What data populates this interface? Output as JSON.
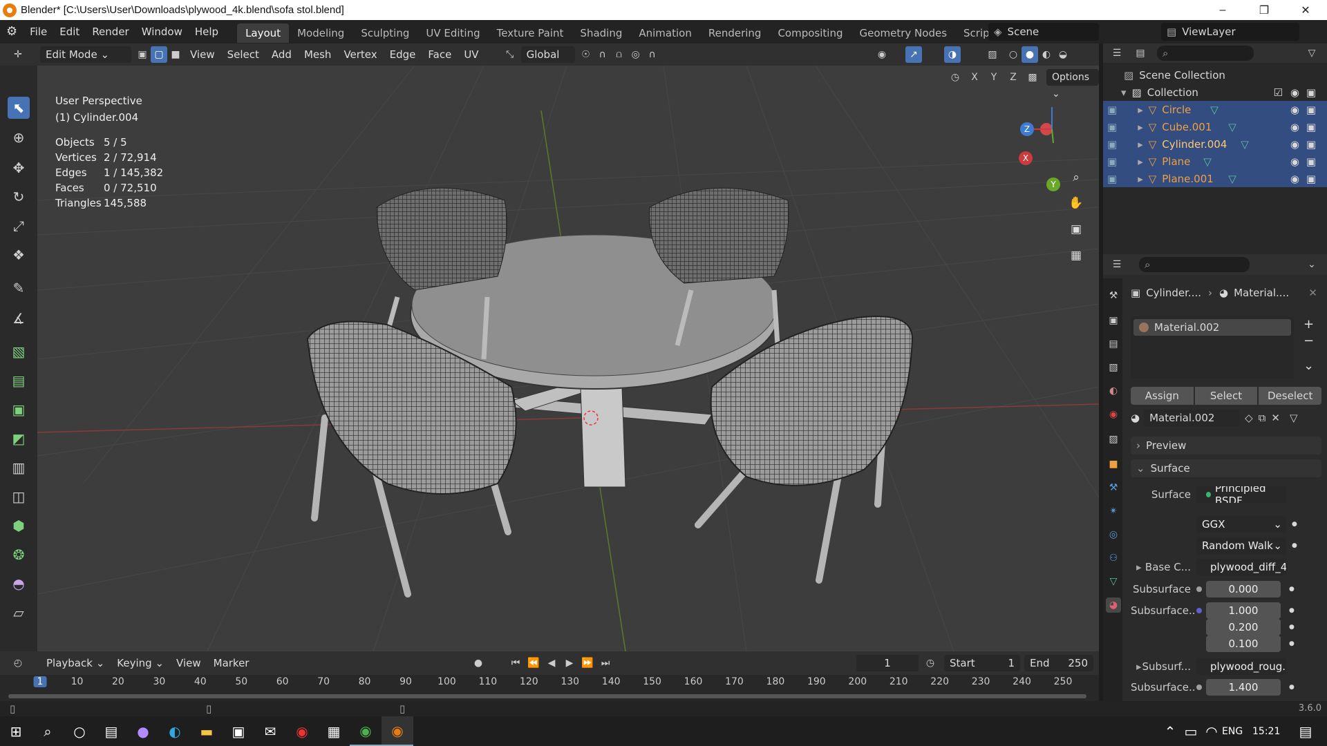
{
  "titlebar": {
    "title": "Blender* [C:\\Users\\User\\Downloads\\plywood_4k.blend\\sofa stol.blend]"
  },
  "menus": [
    "File",
    "Edit",
    "Render",
    "Window",
    "Help"
  ],
  "workspaces": [
    "Layout",
    "Modeling",
    "Sculpting",
    "UV Editing",
    "Texture Paint",
    "Shading",
    "Animation",
    "Rendering",
    "Compositing",
    "Geometry Nodes",
    "Scripting"
  ],
  "scene": {
    "label": "Scene",
    "viewlayer": "ViewLayer"
  },
  "header": {
    "mode": "Edit Mode",
    "items": [
      "View",
      "Select",
      "Add",
      "Mesh",
      "Vertex",
      "Edge",
      "Face",
      "UV"
    ],
    "orientation": "Global",
    "options": "Options",
    "axes": [
      "X",
      "Y",
      "Z"
    ]
  },
  "viewport": {
    "perspective": "User Perspective",
    "object": "(1) Cylinder.004",
    "stats": [
      {
        "label": "Objects",
        "value": "5 / 5"
      },
      {
        "label": "Vertices",
        "value": "2 / 72,914"
      },
      {
        "label": "Edges",
        "value": "1 / 145,382"
      },
      {
        "label": "Faces",
        "value": "0 / 72,510"
      },
      {
        "label": "Triangles",
        "value": "145,588"
      }
    ],
    "gizmo": {
      "x": "X",
      "y": "Y",
      "z": "Z"
    }
  },
  "outliner": {
    "scene_collection": "Scene Collection",
    "collection": "Collection",
    "objects": [
      "Circle",
      "Cube.001",
      "Cylinder.004",
      "Plane",
      "Plane.001"
    ]
  },
  "properties": {
    "breadcrumb_obj": "Cylinder....",
    "breadcrumb_mat": "Material....",
    "slot": "Material.002",
    "assign": "Assign",
    "select": "Select",
    "deselect": "Deselect",
    "material_name": "Material.002",
    "preview": "Preview",
    "surface_panel": "Surface",
    "rows": [
      {
        "label": "Surface",
        "value": "Principled BSDF"
      },
      {
        "label": "",
        "value": "GGX"
      },
      {
        "label": "",
        "value": "Random Walk"
      },
      {
        "label": "Base C...",
        "value": "plywood_diff_4..."
      },
      {
        "label": "Subsurface",
        "value": "0.000"
      },
      {
        "label": "Subsurface...",
        "value": "1.000"
      },
      {
        "label": "",
        "value": "0.200"
      },
      {
        "label": "",
        "value": "0.100"
      },
      {
        "label": "Subsurf...",
        "value": "plywood_roug..."
      },
      {
        "label": "Subsurface...",
        "value": "1.400"
      }
    ]
  },
  "timeline": {
    "menus": [
      "Playback",
      "Keying",
      "View",
      "Marker"
    ],
    "current_frame": "1",
    "start_label": "Start",
    "start": "1",
    "end_label": "End",
    "end": "250",
    "ticks": [
      "1",
      "10",
      "20",
      "30",
      "40",
      "50",
      "60",
      "70",
      "80",
      "90",
      "100",
      "110",
      "120",
      "130",
      "140",
      "150",
      "160",
      "170",
      "180",
      "190",
      "200",
      "210",
      "220",
      "230",
      "240",
      "250"
    ]
  },
  "status": {
    "version": "3.6.0"
  },
  "taskbar": {
    "lang": "ENG",
    "time": "15:21"
  }
}
